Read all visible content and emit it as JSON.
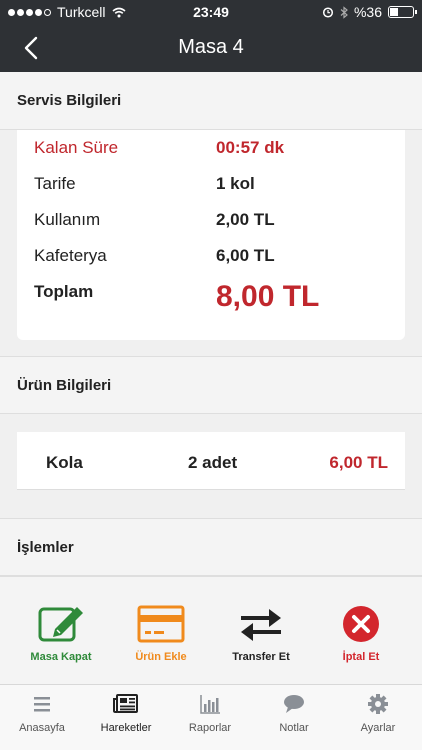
{
  "status_bar": {
    "carrier": "Turkcell",
    "time": "23:49",
    "battery": "%36",
    "battery_level": 0.36
  },
  "nav": {
    "title": "Masa 4"
  },
  "service": {
    "heading": "Servis Bilgileri",
    "remaining_label": "Kalan Süre",
    "remaining_value": "00:57 dk",
    "tariff_label": "Tarife",
    "tariff_value": "1 kol",
    "usage_label": "Kullanım",
    "usage_value": "2,00 TL",
    "cafe_label": "Kafeterya",
    "cafe_value": "6,00 TL",
    "total_label": "Toplam",
    "total_value": "8,00 TL"
  },
  "products": {
    "heading": "Ürün Bilgileri",
    "items": [
      {
        "name": "Kola",
        "qty": "2 adet",
        "price": "6,00 TL"
      }
    ]
  },
  "operations": {
    "heading": "İşlemler",
    "close_label": "Masa Kapat",
    "add_label": "Ürün Ekle",
    "transfer_label": "Transfer Et",
    "cancel_label": "İptal Et"
  },
  "colors": {
    "close": "#2f8a3a",
    "add": "#f08a1c",
    "transfer": "#222222",
    "cancel": "#d3262d",
    "accent_red": "#c0272d"
  },
  "tabs": [
    {
      "label": "Anasayfa",
      "icon": "menu-icon"
    },
    {
      "label": "Hareketler",
      "icon": "newspaper-icon"
    },
    {
      "label": "Raporlar",
      "icon": "bar-chart-icon"
    },
    {
      "label": "Notlar",
      "icon": "speech-bubble-icon"
    },
    {
      "label": "Ayarlar",
      "icon": "gear-icon"
    }
  ]
}
